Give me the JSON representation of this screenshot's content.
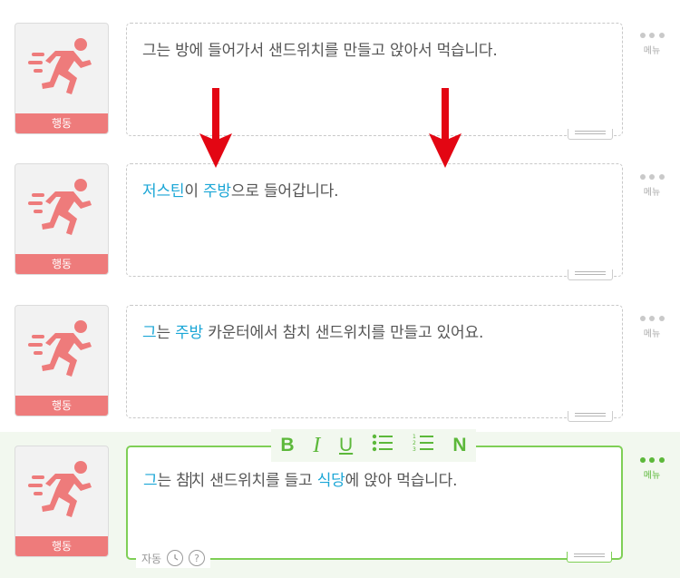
{
  "rows": [
    {
      "tag": "행동",
      "segments": [
        {
          "t": "그는 방에 들어가서 샌드위치를 만들고 앉아서 먹습니다.",
          "hl": false
        }
      ]
    },
    {
      "tag": "행동",
      "segments": [
        {
          "t": "저스틴",
          "hl": true
        },
        {
          "t": "이 ",
          "hl": false
        },
        {
          "t": "주방",
          "hl": true
        },
        {
          "t": "으로 들어갑니다.",
          "hl": false
        }
      ]
    },
    {
      "tag": "행동",
      "segments": [
        {
          "t": "그",
          "hl": true
        },
        {
          "t": "는 ",
          "hl": false
        },
        {
          "t": "주방",
          "hl": true
        },
        {
          "t": " 카운터에서 참치 샌드위치를 만들고 있어요.",
          "hl": false
        }
      ]
    },
    {
      "tag": "행동",
      "segments": [
        {
          "t": "그",
          "hl": true
        },
        {
          "t": "는 참",
          "hl": false
        },
        {
          "t": "치 샌드위치를 들고 ",
          "hl": false
        },
        {
          "t": "식당",
          "hl": true
        },
        {
          "t": "에 앉아 먹습니다.",
          "hl": false
        }
      ]
    }
  ],
  "menu_label": "메뉴",
  "toolbar": {
    "bold": "B",
    "italic": "I",
    "underline": "U",
    "bullets": "☰",
    "numbered": "☰",
    "n": "N"
  },
  "bottom": {
    "auto": "자동",
    "help": "?"
  },
  "colors": {
    "tag": "#ee7b7b",
    "highlight": "#1aa6d6",
    "accent": "#5cb83a",
    "arrow": "#e30613"
  }
}
